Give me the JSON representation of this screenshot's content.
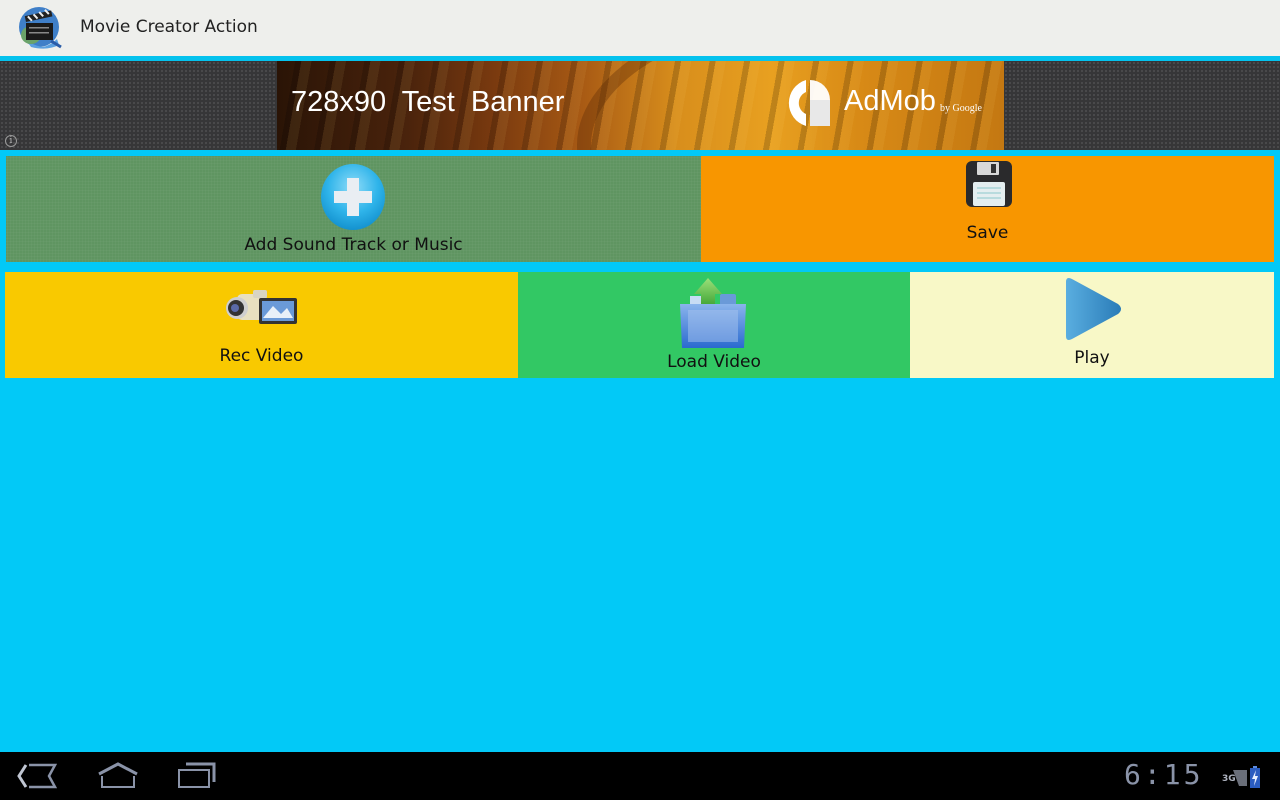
{
  "app": {
    "title": "Movie Creator Action",
    "icon": "clapperboard-globe-icon"
  },
  "ad": {
    "info_icon": "i",
    "banner_text": "728x90 Test Banner",
    "brand": "AdMob",
    "brand_suffix": "by Google"
  },
  "buttons": {
    "add_sound": {
      "label": "Add Sound Track or Music",
      "icon": "plus-circle-icon",
      "color": "#5f9561"
    },
    "save": {
      "label": "Save",
      "icon": "floppy-disk-icon",
      "color": "#f89600"
    },
    "rec_video": {
      "label": "Rec Video",
      "icon": "camcorder-icon",
      "color": "#f9c900"
    },
    "load_video": {
      "label": "Load Video",
      "icon": "folder-upload-icon",
      "color": "#32c864"
    },
    "play": {
      "label": "Play",
      "icon": "play-icon",
      "color": "#f8f8c7"
    }
  },
  "theme": {
    "background": "#02c9f7",
    "titlebar": "#eeefec",
    "accent_line": "#05c2ed"
  },
  "system_bar": {
    "back": "back-icon",
    "home": "home-icon",
    "recents": "recent-apps-icon",
    "time": "6:15",
    "network": "3G"
  }
}
